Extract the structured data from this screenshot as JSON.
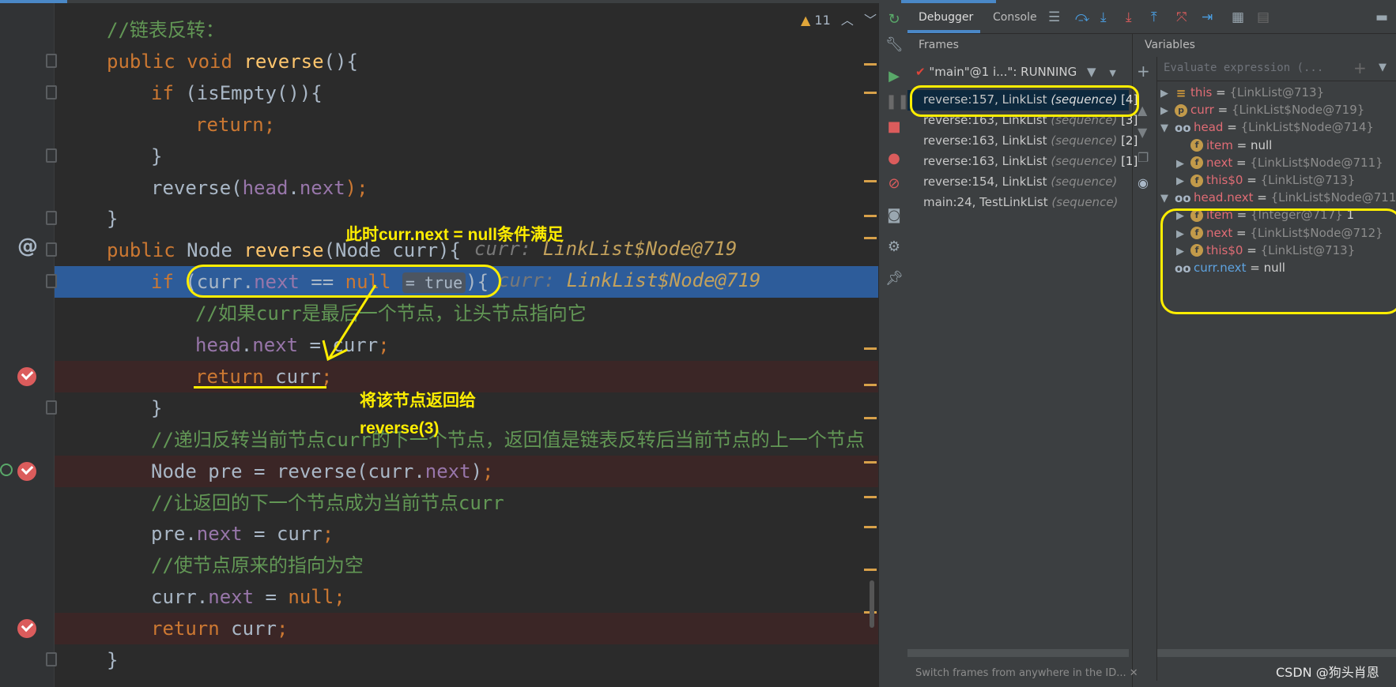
{
  "editor": {
    "lines": [
      {
        "k": "c1",
        "parts": [
          {
            "c": "cmt",
            "t": "//链表反转："
          }
        ]
      },
      {
        "k": "c2",
        "parts": [
          {
            "c": "kw",
            "t": "public void "
          },
          {
            "c": "fn",
            "t": "reverse"
          },
          {
            "c": "",
            "t": "(){"
          }
        ]
      },
      {
        "k": "c3",
        "parts": [
          {
            "c": "kw",
            "t": "if "
          },
          {
            "c": "",
            "t": "(isEmpty()){"
          }
        ]
      },
      {
        "k": "c4",
        "parts": [
          {
            "c": "kw",
            "t": "return;"
          }
        ]
      },
      {
        "k": "c5",
        "parts": [
          {
            "c": "",
            "t": "}"
          }
        ]
      },
      {
        "k": "c6",
        "parts": [
          {
            "c": "",
            "t": "reverse("
          },
          {
            "c": "fld",
            "t": "head"
          },
          {
            "c": "",
            "t": "."
          },
          {
            "c": "fld",
            "t": "next"
          },
          {
            "c": "kw",
            "t": ");"
          }
        ]
      },
      {
        "k": "c7",
        "parts": [
          {
            "c": "",
            "t": "}"
          }
        ]
      },
      {
        "k": "c8",
        "parts": [
          {
            "c": "kw",
            "t": "public "
          },
          {
            "c": "",
            "t": "Node "
          },
          {
            "c": "fn",
            "t": "reverse"
          },
          {
            "c": "",
            "t": "(Node curr){"
          }
        ]
      },
      {
        "k": "c9",
        "parts": [
          {
            "c": "kw",
            "t": "if "
          },
          {
            "c": "",
            "t": "(curr."
          },
          {
            "c": "fld",
            "t": "next"
          },
          {
            "c": "",
            "t": " == "
          },
          {
            "c": "kw",
            "t": "null"
          }
        ]
      },
      {
        "k": "c10",
        "parts": [
          {
            "c": "cmt",
            "t": "//如果curr是最后一个节点，让头节点指向它"
          }
        ]
      },
      {
        "k": "c11",
        "parts": [
          {
            "c": "fld",
            "t": "head"
          },
          {
            "c": "",
            "t": "."
          },
          {
            "c": "fld",
            "t": "next"
          },
          {
            "c": "",
            "t": " = curr"
          },
          {
            "c": "kw",
            "t": ";"
          }
        ]
      },
      {
        "k": "c12",
        "parts": [
          {
            "c": "kw",
            "t": "return "
          },
          {
            "c": "",
            "t": "curr"
          },
          {
            "c": "kw",
            "t": ";"
          }
        ]
      },
      {
        "k": "c13",
        "parts": [
          {
            "c": "",
            "t": "}"
          }
        ]
      },
      {
        "k": "c14",
        "parts": [
          {
            "c": "cmt",
            "t": "//递归反转当前节点curr的下一个节点，返回值是链表反转后当前节点的上一个节点"
          }
        ]
      },
      {
        "k": "c15",
        "parts": [
          {
            "c": "",
            "t": "Node pre = reverse(curr."
          },
          {
            "c": "fld",
            "t": "next"
          },
          {
            "c": "",
            "t": ")"
          },
          {
            "c": "kw",
            "t": ";"
          }
        ]
      },
      {
        "k": "c16",
        "parts": [
          {
            "c": "cmt",
            "t": "//让返回的下一个节点成为当前节点curr"
          }
        ]
      },
      {
        "k": "c17",
        "parts": [
          {
            "c": "",
            "t": "pre."
          },
          {
            "c": "fld",
            "t": "next"
          },
          {
            "c": "",
            "t": " = curr"
          },
          {
            "c": "kw",
            "t": ";"
          }
        ]
      },
      {
        "k": "c18",
        "parts": [
          {
            "c": "cmt",
            "t": "//使节点原来的指向为空"
          }
        ]
      },
      {
        "k": "c19",
        "parts": [
          {
            "c": "",
            "t": "curr."
          },
          {
            "c": "fld",
            "t": "next"
          },
          {
            "c": "",
            "t": " = "
          },
          {
            "c": "kw",
            "t": "null;"
          }
        ]
      },
      {
        "k": "c20",
        "parts": [
          {
            "c": "kw",
            "t": "return "
          },
          {
            "c": "",
            "t": "curr"
          },
          {
            "c": "kw",
            "t": ";"
          }
        ]
      },
      {
        "k": "c21",
        "parts": [
          {
            "c": "",
            "t": "}"
          }
        ]
      }
    ],
    "line9_tail": "){",
    "bool_hint": "= true",
    "hint_line8": {
      "name": "curr: ",
      "value": "LinkList$Node@719"
    },
    "hint_line9": {
      "name": "curr: ",
      "value": "LinkList$Node@719"
    },
    "warning_count": "11",
    "at_symbol": "@"
  },
  "annotations": {
    "top": "此时curr.next = null条件满足",
    "mid1": "将该节点返回给",
    "mid2": "reverse(3)"
  },
  "debugger": {
    "tabs": [
      "Debugger",
      "Console"
    ],
    "frames_header": "Frames",
    "variables_header": "Variables",
    "thread": "\"main\"@1 i...\": RUNNING",
    "frames": [
      {
        "name": "reverse:157, LinkList",
        "ctx": "(sequence)",
        "num": "[4]"
      },
      {
        "name": "reverse:163, LinkList",
        "ctx": "(sequence)",
        "num": "[3]"
      },
      {
        "name": "reverse:163, LinkList",
        "ctx": "(sequence)",
        "num": "[2]"
      },
      {
        "name": "reverse:163, LinkList",
        "ctx": "(sequence)",
        "num": "[1]"
      },
      {
        "name": "reverse:154, LinkList",
        "ctx": "(sequence)",
        "num": ""
      },
      {
        "name": "main:24, TestLinkList",
        "ctx": "(sequence)",
        "num": ""
      }
    ],
    "eval_placeholder": "Evaluate expression (...",
    "variables": [
      {
        "icon": "≡",
        "name": "this",
        "eq": " = ",
        "val": "{LinkList@713}",
        "extra": ""
      },
      {
        "icon": "p",
        "name": "curr",
        "eq": " = ",
        "val": "{LinkList$Node@719}",
        "extra": ""
      },
      {
        "icon": "oo",
        "name": "head",
        "eq": " = ",
        "val": "{LinkList$Node@714}",
        "extra": ""
      },
      {
        "icon": "f",
        "name": "item",
        "eq": " = ",
        "val": "",
        "extra": "null"
      },
      {
        "icon": "f",
        "name": "next",
        "eq": " = ",
        "val": "{LinkList$Node@711}",
        "extra": ""
      },
      {
        "icon": "f",
        "name": "this$0",
        "eq": " = ",
        "val": "{LinkList@713}",
        "extra": ""
      },
      {
        "icon": "oo",
        "name": "head.next",
        "eq": " = ",
        "val": "{LinkList$Node@711}",
        "extra": ""
      },
      {
        "icon": "f",
        "name": "item",
        "eq": " = ",
        "val": "{Integer@717} ",
        "extra": "1"
      },
      {
        "icon": "f",
        "name": "next",
        "eq": " = ",
        "val": "{LinkList$Node@712}",
        "extra": ""
      },
      {
        "icon": "f",
        "name": "this$0",
        "eq": " = ",
        "val": "{LinkList@713}",
        "extra": ""
      },
      {
        "icon": "oo",
        "name": "curr.next",
        "eq": " = ",
        "val": "",
        "extra": "null"
      }
    ],
    "switch_hint": "Switch frames from anywhere in the ID..."
  },
  "watermark": "CSDN @狗头肖恩",
  "colors": {
    "accent": "#4a88c7",
    "annotation": "#ffee00",
    "breakpoint": "#db5c5c",
    "exec_line": "#2d5c9a"
  },
  "icons": [
    "rerun-icon",
    "wrench-icon",
    "resume-icon",
    "pause-icon",
    "stop-icon",
    "view-breakpoints-icon",
    "mute-breakpoints-icon",
    "camera-icon",
    "settings-icon",
    "pin-icon",
    "list-icon",
    "step-over-icon",
    "step-into-icon",
    "force-step-into-icon",
    "step-out-icon",
    "drop-frame-icon",
    "run-to-cursor-icon",
    "table-icon",
    "filter-icon",
    "add-icon",
    "eye-icon",
    "close-icon"
  ]
}
